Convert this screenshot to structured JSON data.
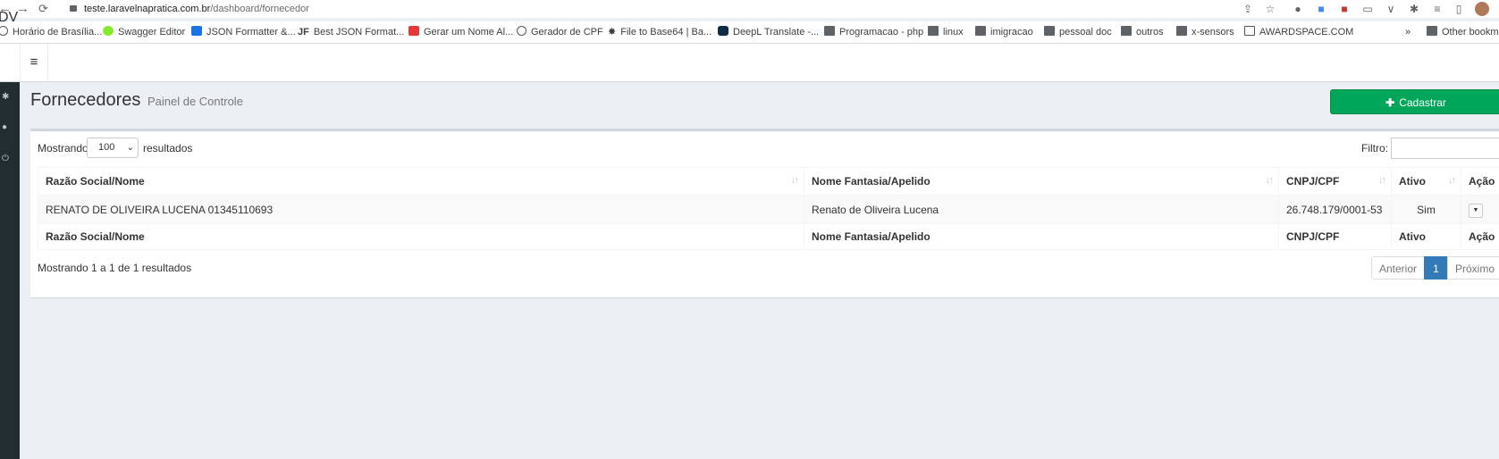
{
  "browser": {
    "url_host": "teste.laravelnapratica.com.br",
    "url_path": "/dashboard/fornecedor",
    "bookmarks": [
      {
        "label": "Horário de Brasília..."
      },
      {
        "label": "Swagger Editor"
      },
      {
        "label": "JSON Formatter &..."
      },
      {
        "label": "Best JSON Format..."
      },
      {
        "label": "Gerar um Nome Al..."
      },
      {
        "label": "Gerador de CPF"
      },
      {
        "label": "File to Base64 | Ba..."
      },
      {
        "label": "DeepL Translate -..."
      },
      {
        "label": "Programacao - php"
      },
      {
        "label": "linux"
      },
      {
        "label": "imigracao"
      },
      {
        "label": "pessoal doc"
      },
      {
        "label": "outros"
      },
      {
        "label": "x-sensors"
      },
      {
        "label": "AWARDSPACE.COM"
      }
    ],
    "overflow": "»",
    "other_bookmarks": "Other bookma"
  },
  "app": {
    "logo": "DV",
    "menu_icon": "≡"
  },
  "page": {
    "title": "Fornecedores",
    "subtitle": "Painel de Controle",
    "add_button": "Cadastrar"
  },
  "table_controls": {
    "showing_prefix": "Mostrando",
    "page_size": "100",
    "showing_suffix": "resultados",
    "filter_label": "Filtro:",
    "info": "Mostrando 1 a 1 de 1 resultados"
  },
  "table": {
    "columns": [
      "Razão Social/Nome",
      "Nome Fantasia/Apelido",
      "CNPJ/CPF",
      "Ativo",
      "Ação"
    ],
    "rows": [
      {
        "razao": "RENATO DE OLIVEIRA LUCENA 01345110693",
        "fantasia": "Renato de Oliveira Lucena",
        "cnpj": "26.748.179/0001-53",
        "ativo": "Sim"
      }
    ]
  },
  "pagination": {
    "prev": "Anterior",
    "current": "1",
    "next": "Próximo"
  },
  "colors": {
    "sidebar": "#222d32",
    "success": "#00a65a",
    "primary": "#337ab7",
    "background": "#ecf0f5"
  }
}
